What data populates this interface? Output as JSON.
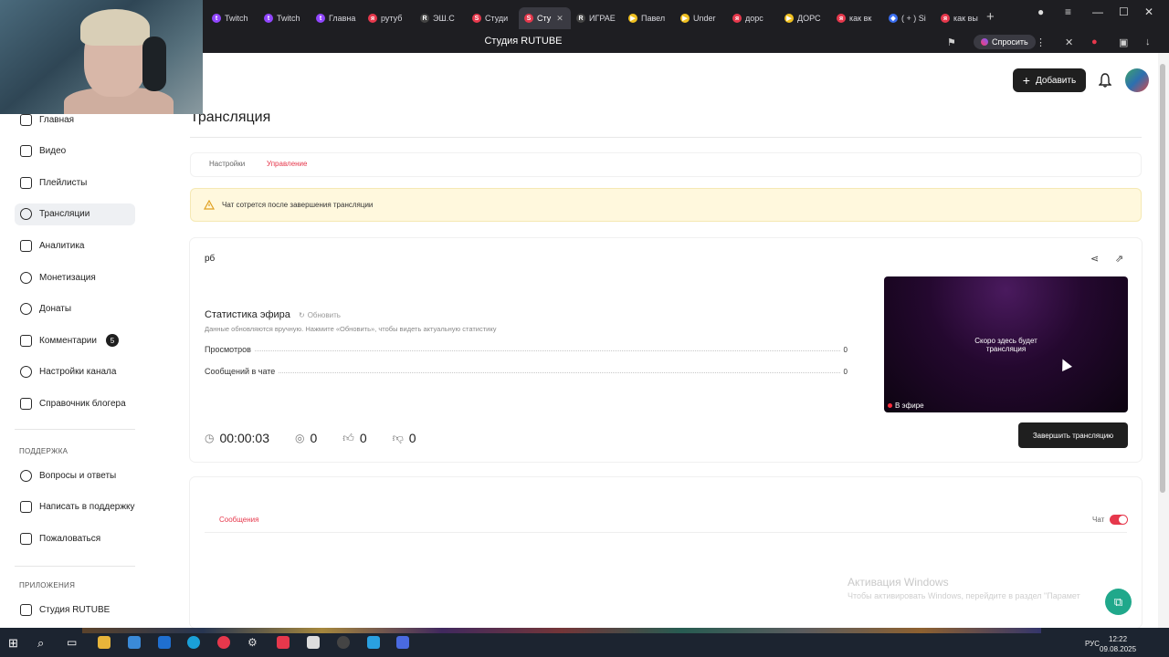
{
  "browser": {
    "tabs": [
      {
        "label": "Twitch",
        "color": "#9146ff",
        "glyph": "t"
      },
      {
        "label": "Twitch",
        "color": "#9146ff",
        "glyph": "t"
      },
      {
        "label": "Главна",
        "color": "#9146ff",
        "glyph": "t"
      },
      {
        "label": "рутуб",
        "color": "#e6384c",
        "glyph": "я"
      },
      {
        "label": "ЭШ.С",
        "color": "#444444",
        "glyph": "R"
      },
      {
        "label": "Студи",
        "color": "#e6384c",
        "glyph": "S"
      },
      {
        "label": "Сту",
        "color": "#e6384c",
        "glyph": "S",
        "active": true
      },
      {
        "label": "ИГРАЕ",
        "color": "#444444",
        "glyph": "R"
      },
      {
        "label": "Павел",
        "color": "#f0c020",
        "glyph": "▶"
      },
      {
        "label": "Under",
        "color": "#f0c020",
        "glyph": "▶"
      },
      {
        "label": "дорс",
        "color": "#e6384c",
        "glyph": "я"
      },
      {
        "label": "ДОРС",
        "color": "#f0c020",
        "glyph": "▶"
      },
      {
        "label": "как вк",
        "color": "#e6384c",
        "glyph": "я"
      },
      {
        "label": "( + ) Si",
        "color": "#3a6ef0",
        "glyph": "◆"
      },
      {
        "label": "как вы",
        "color": "#e6384c",
        "glyph": "я"
      }
    ],
    "page_title": "Студия RUTUBE",
    "ask_label": "Спросить"
  },
  "sidebar": {
    "items": [
      {
        "label": "Главная",
        "icon": "home-icon"
      },
      {
        "label": "Видео",
        "icon": "video-icon"
      },
      {
        "label": "Плейлисты",
        "icon": "playlist-icon"
      },
      {
        "label": "Трансляции",
        "icon": "broadcast-icon",
        "active": true
      },
      {
        "label": "Аналитика",
        "icon": "analytics-icon"
      },
      {
        "label": "Монетизация",
        "icon": "money-icon"
      },
      {
        "label": "Донаты",
        "icon": "donate-icon"
      },
      {
        "label": "Комментарии",
        "icon": "comment-icon",
        "badge": "5"
      },
      {
        "label": "Настройки канала",
        "icon": "gear-icon"
      },
      {
        "label": "Справочник блогера",
        "icon": "book-icon"
      }
    ],
    "support_section": "Поддержка",
    "support_items": [
      {
        "label": "Вопросы и ответы",
        "icon": "faq-icon"
      },
      {
        "label": "Написать в поддержку",
        "icon": "mail-icon"
      },
      {
        "label": "Пожаловаться",
        "icon": "flag-icon"
      }
    ],
    "apps_section": "Приложения",
    "apps_items": [
      {
        "label": "Студия RUTUBE",
        "icon": "studio-icon"
      }
    ]
  },
  "header": {
    "add_label": "Добавить"
  },
  "main": {
    "title": "Трансляция",
    "tabs": [
      "Настройки",
      "Управление"
    ],
    "active_tab": "Управление",
    "warning": "Чат сотрется после завершения трансляции",
    "stream_name": "рб",
    "stats": {
      "title": "Статистика эфира",
      "refresh": "Обновить",
      "hint": "Данные обновляются вручную. Нажмите «Обновить», чтобы видеть актуальную статистику",
      "rows": [
        {
          "label": "Просмотров",
          "value": "0"
        },
        {
          "label": "Сообщений в чате",
          "value": "0"
        }
      ]
    },
    "preview": {
      "text_line1": "Скоро здесь будет",
      "text_line2": "трансляция",
      "live": "В эфире"
    },
    "duration": "00:00:03",
    "viewers": "0",
    "likes": "0",
    "dislikes": "0",
    "end_button": "Завершить трансляцию",
    "messages_tab": "Сообщения",
    "chat_label": "Чат",
    "chat_enabled": true
  },
  "overlay": {
    "activate_title": "Активация Windows",
    "activate_sub": "Чтобы активировать Windows, перейдите в раздел \"Парамет"
  },
  "taskbar": {
    "time": "12:22",
    "date": "09.08.2025",
    "lang": "РУС"
  },
  "colors": {
    "accent": "#e6384c",
    "dark_button": "#1f1f1f",
    "warning_bg": "#fff8dd",
    "fab": "#20a88b"
  }
}
